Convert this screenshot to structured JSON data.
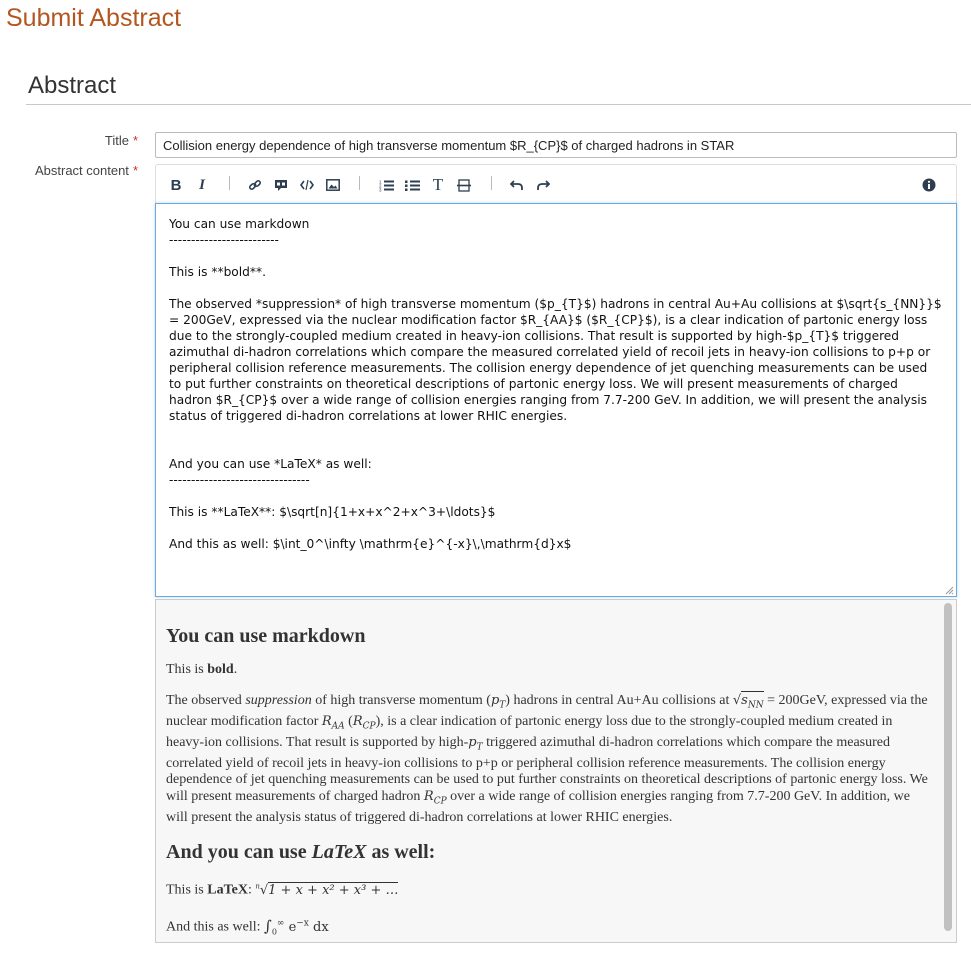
{
  "page": {
    "title": "Submit Abstract"
  },
  "section": {
    "title": "Abstract"
  },
  "fields": {
    "title": {
      "label": "Title",
      "required_mark": "*",
      "value": "Collision energy dependence of high transverse momentum $R_{CP}$ of charged hadrons in STAR"
    },
    "abstract": {
      "label": "Abstract content",
      "required_mark": "*"
    }
  },
  "toolbar": {
    "buttons": [
      "bold-icon",
      "italic-icon",
      "link-icon",
      "quote-icon",
      "code-icon",
      "image-icon",
      "ordered-list-icon",
      "unordered-list-icon",
      "heading-icon",
      "horizontal-rule-icon",
      "undo-icon",
      "redo-icon",
      "info-icon"
    ],
    "bold_label": "B",
    "italic_label": "I",
    "heading_label": "T"
  },
  "editor": {
    "lines": [
      "You can use markdown",
      "-------------------------",
      "",
      "This is **bold**.",
      "",
      "The observed *suppression* of high transverse momentum ($p_{T}$) hadrons in central Au+Au collisions at $\\sqrt{s_{NN}}$ = 200GeV, expressed via the nuclear modification factor $R_{AA}$ ($R_{CP}$), is a clear indication of partonic energy loss due to the strongly-coupled medium created in heavy-ion collisions. That result is supported by high-$p_{T}$ triggered azimuthal di-hadron correlations which compare the measured correlated yield of recoil jets in heavy-ion collisions to p+p or peripheral collision reference measurements. The collision energy dependence of jet quenching measurements can be used to put further constraints on theoretical descriptions of partonic energy loss. We will present measurements of charged hadron $R_{CP}$ over a wide range of collision energies ranging from 7.7-200 GeV. In addition, we will present the analysis status of triggered di-hadron correlations at lower RHIC energies.",
      "",
      "",
      "And you can use *LaTeX* as well:",
      "--------------------------------",
      "",
      "This is **LaTeX**: $\\sqrt[n]{1+x+x^2+x^3+\\ldots}$",
      "",
      "And this as well: $\\int_0^\\infty \\mathrm{e}^{-x}\\,\\mathrm{d}x$"
    ]
  },
  "preview": {
    "heading1": "You can use markdown",
    "bold_line": {
      "prefix": "This is ",
      "bold": "bold",
      "suffix": "."
    },
    "paragraph": {
      "part1": "The observed ",
      "em1": "suppression",
      "part2": " of high transverse momentum (",
      "math_pt": "p",
      "math_pt_sub": "T",
      "part3": ") hadrons in central Au+Au collisions at ",
      "sqrt_text": "s",
      "sqrt_sub": "NN",
      "part4": " = 200GeV, expressed via the nuclear modification factor ",
      "math_raa": "R",
      "math_raa_sub": "AA",
      "part5": " (",
      "math_rcp": "R",
      "math_rcp_sub": "CP",
      "part6": "), is a clear indication of partonic energy loss due to the strongly-coupled medium created in heavy-ion collisions. That result is supported by high-",
      "part7": " triggered azimuthal di-hadron correlations which compare the measured correlated yield of recoil jets in heavy-ion collisions to p+p or peripheral collision reference measurements. The collision energy dependence of jet quenching measurements can be used to put further constraints on theoretical descriptions of partonic energy loss. We will present measurements of charged hadron ",
      "part8": " over a wide range of collision energies ranging from 7.7-200 GeV. In addition, we will present the analysis status of triggered di-hadron correlations at lower RHIC energies."
    },
    "heading2_prefix": "And you can use ",
    "heading2_em": "LaTeX",
    "heading2_suffix": " as well:",
    "latex_line": {
      "prefix": "This is ",
      "bold": "LaTeX",
      "colon": ":",
      "root_index": "n",
      "root_body": "1 + x + x² + x³ + …"
    },
    "int_line": {
      "prefix": "And this as well: ",
      "int": "∫",
      "lower": "0",
      "upper": "∞",
      "body": "e",
      "exp": "−x",
      "dx": "dx"
    }
  }
}
